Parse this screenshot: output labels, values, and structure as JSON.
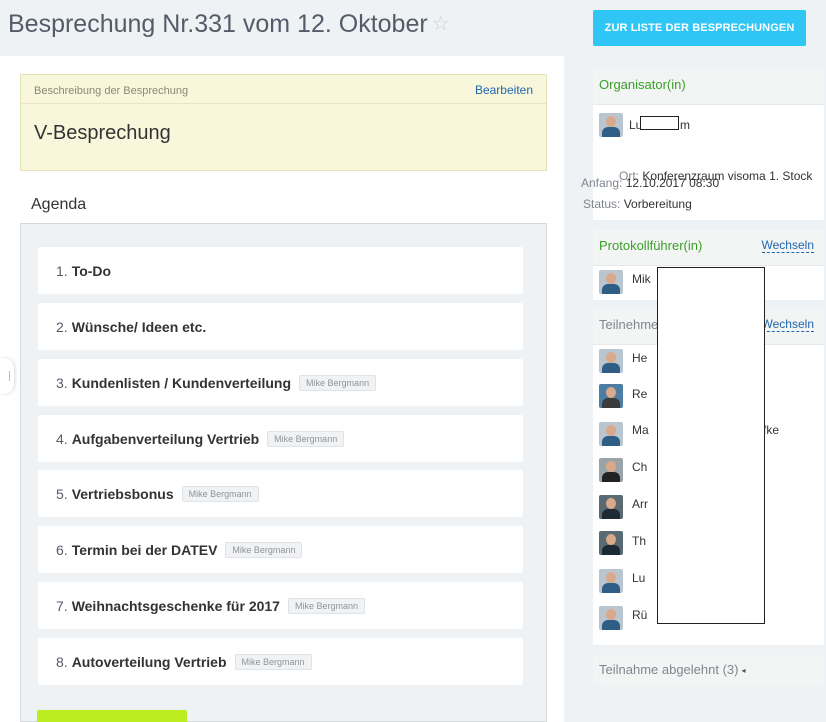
{
  "header": {
    "title": "Besprechung Nr.331 vom 12. Oktober",
    "star": "☆",
    "list_button": "ZUR LISTE DER BESPRECHUNGEN"
  },
  "description": {
    "label": "Beschreibung der Besprechung",
    "edit": "Bearbeiten",
    "title": "V-Besprechung"
  },
  "agenda": {
    "heading": "Agenda",
    "items": [
      {
        "num": "1.",
        "title": "To-Do",
        "tag": ""
      },
      {
        "num": "2.",
        "title": "Wünsche/ Ideen etc.",
        "tag": ""
      },
      {
        "num": "3.",
        "title": "Kundenlisten / Kundenverteilung",
        "tag": "Mike Bergmann"
      },
      {
        "num": "4.",
        "title": "Aufgabenverteilung Vertrieb",
        "tag": "Mike Bergmann"
      },
      {
        "num": "5.",
        "title": "Vertriebsbonus",
        "tag": "Mike Bergmann"
      },
      {
        "num": "6.",
        "title": "Termin bei der DATEV",
        "tag": "Mike Bergmann"
      },
      {
        "num": "7.",
        "title": "Weihnachtsgeschenke für 2017",
        "tag": "Mike Bergmann"
      },
      {
        "num": "8.",
        "title": "Autoverteilung Vertrieb",
        "tag": "Mike Bergmann"
      }
    ]
  },
  "organizer": {
    "heading": "Organisator(in)",
    "name_start": "Lu",
    "name_end": "m",
    "place_label": "Ort:",
    "place": "Konferenzraum visoma 1. Stock",
    "start_label": "Anfang:",
    "start": "12.10.2017 08:30",
    "status_label": "Status:",
    "status": "Vorbereitung"
  },
  "keeper": {
    "heading": "Protokollführer(in)",
    "switch": "Wechseln",
    "name": "Mik"
  },
  "participants": {
    "heading": "Teilnehme",
    "switch": "Wechseln",
    "names": [
      "He",
      "Re",
      "Ma",
      "Ch",
      "Arr",
      "Th",
      "Lu",
      "Rü"
    ],
    "suffix": "fke"
  },
  "declined": {
    "label": "Teilnahme abgelehnt (3)",
    "arrow": "◂"
  }
}
